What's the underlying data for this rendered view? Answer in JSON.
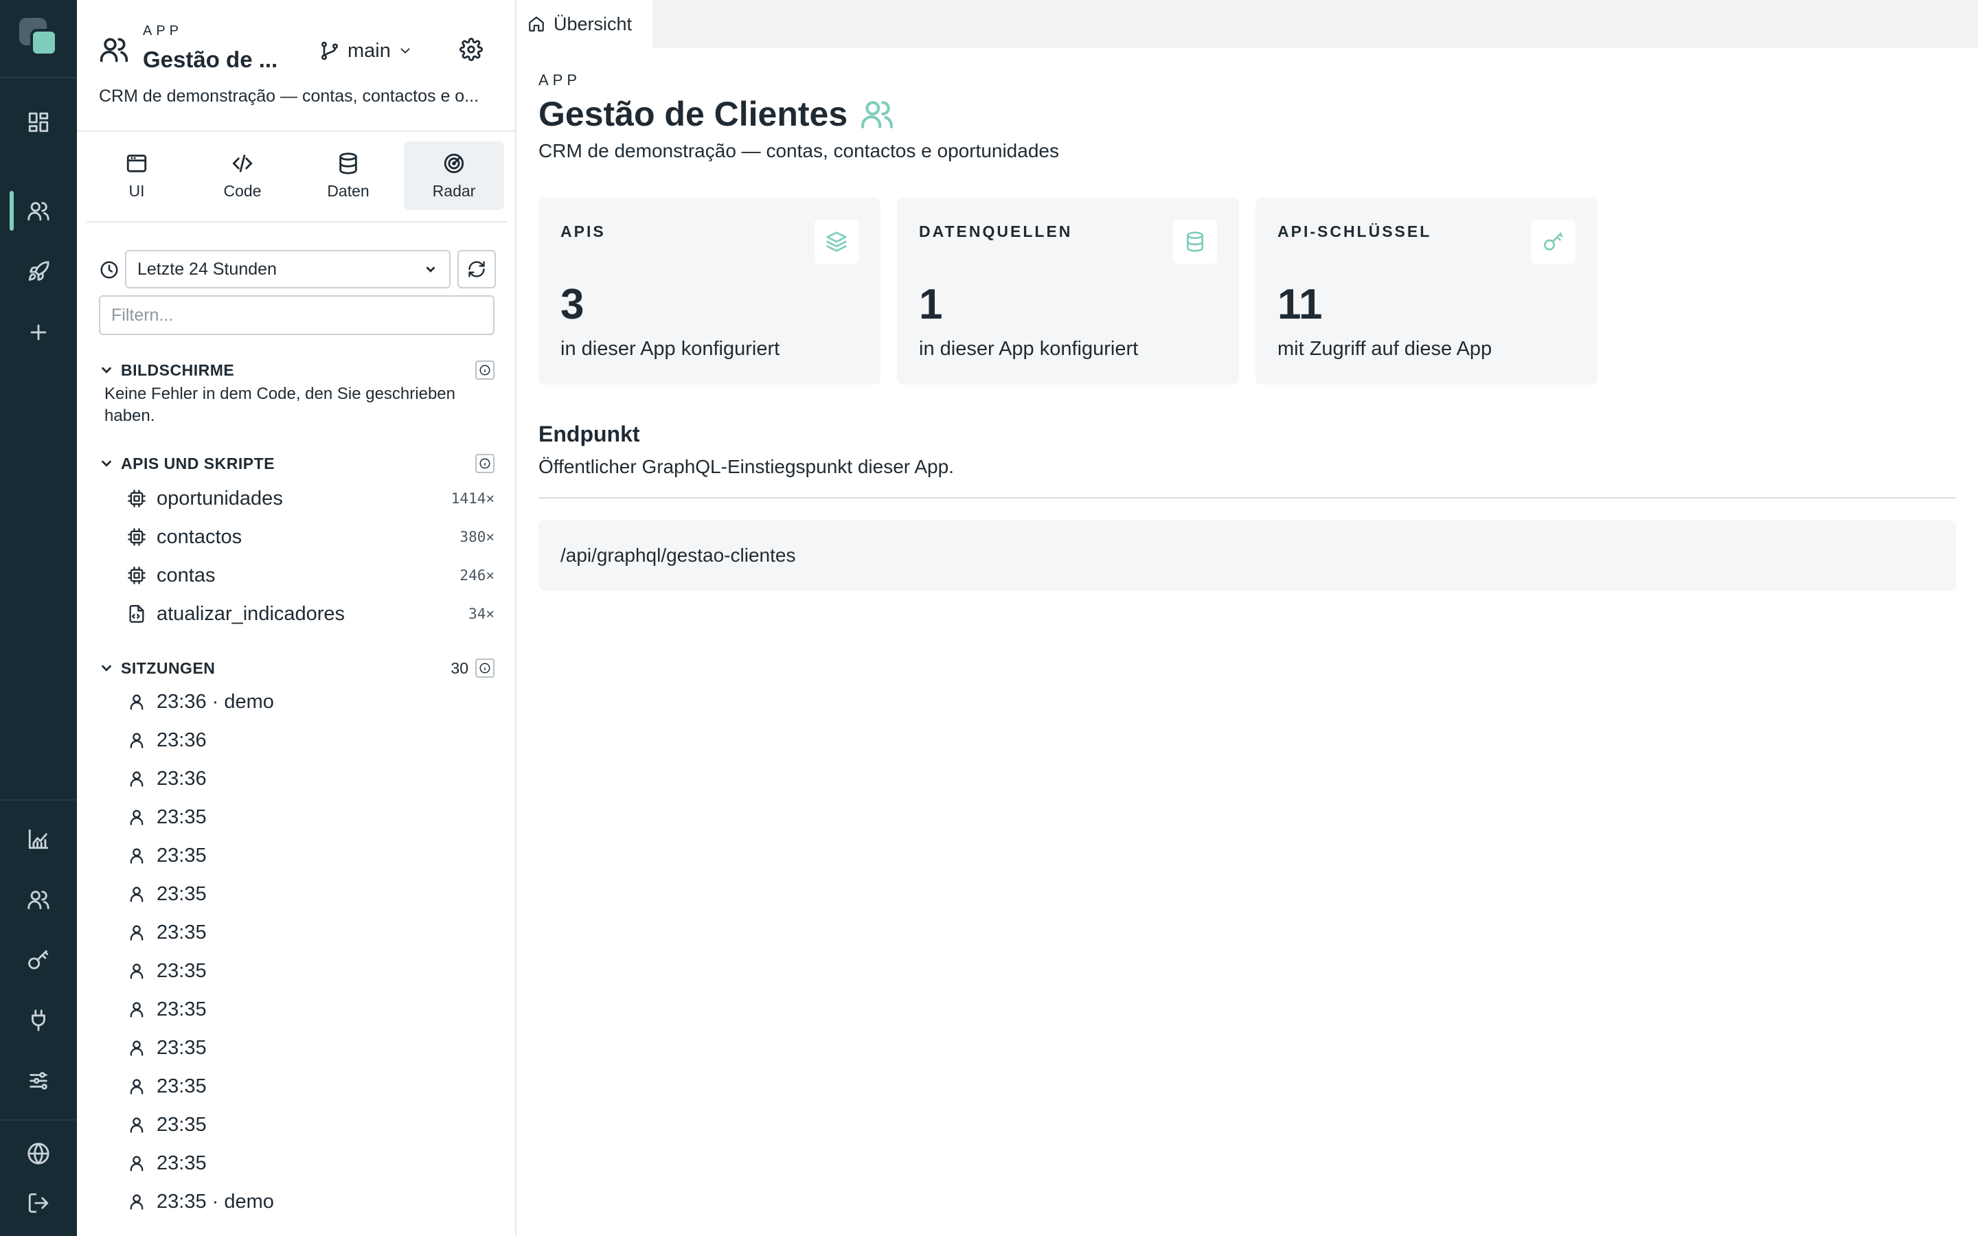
{
  "rail": {
    "icons": [
      "dashboard-icon",
      "users-icon",
      "rocket-icon",
      "plus-icon",
      "chart-icon",
      "team-icon",
      "key-icon",
      "plug-icon",
      "sliders-icon",
      "globe-icon",
      "logout-icon"
    ],
    "accent": "#7ecdbc",
    "background": "#172b35"
  },
  "app_header": {
    "kicker": "APP",
    "title": "Gestão de ...",
    "branch": "main",
    "description": "CRM de demonstração — contas, contactos e o..."
  },
  "side_tabs": [
    {
      "label": "UI",
      "icon": "window-icon"
    },
    {
      "label": "Code",
      "icon": "code-icon"
    },
    {
      "label": "Daten",
      "icon": "database-icon"
    },
    {
      "label": "Radar",
      "icon": "radar-icon",
      "active": true
    }
  ],
  "filters": {
    "time_range": "Letzte 24 Stunden",
    "filter_placeholder": "Filtern..."
  },
  "sections": {
    "screens": {
      "label": "BILDSCHIRME",
      "empty_text": "Keine Fehler in dem Code, den Sie geschrieben haben."
    },
    "apis": {
      "label": "APIS UND SKRIPTE",
      "items": [
        {
          "name": "oportunidades",
          "count": "1414×",
          "icon": "chip-icon"
        },
        {
          "name": "contactos",
          "count": "380×",
          "icon": "chip-icon"
        },
        {
          "name": "contas",
          "count": "246×",
          "icon": "chip-icon"
        },
        {
          "name": "atualizar_indicadores",
          "count": "34×",
          "icon": "script-file-icon"
        }
      ]
    },
    "sessions": {
      "label": "SITZUNGEN",
      "count": "30",
      "items": [
        "23:36 · demo",
        "23:36",
        "23:36",
        "23:35",
        "23:35",
        "23:35",
        "23:35",
        "23:35",
        "23:35",
        "23:35",
        "23:35",
        "23:35",
        "23:35",
        "23:35 · demo"
      ]
    }
  },
  "main": {
    "tab_label": "Übersicht",
    "kicker": "APP",
    "title": "Gestão de Clientes",
    "subtitle": "CRM de demonstração — contas, contactos e oportunidades",
    "cards": [
      {
        "label": "APIS",
        "value": "3",
        "caption": "in dieser App konfiguriert",
        "icon": "layers-icon"
      },
      {
        "label": "DATENQUELLEN",
        "value": "1",
        "caption": "in dieser App konfiguriert",
        "icon": "database-icon"
      },
      {
        "label": "API-SCHLÜSSEL",
        "value": "11",
        "caption": "mit Zugriff auf diese App",
        "icon": "key-icon"
      }
    ],
    "endpoint": {
      "title": "Endpunkt",
      "description": "Öffentlicher GraphQL-Einstiegspunkt dieser App.",
      "url": "/api/graphql/gestao-clientes"
    }
  }
}
